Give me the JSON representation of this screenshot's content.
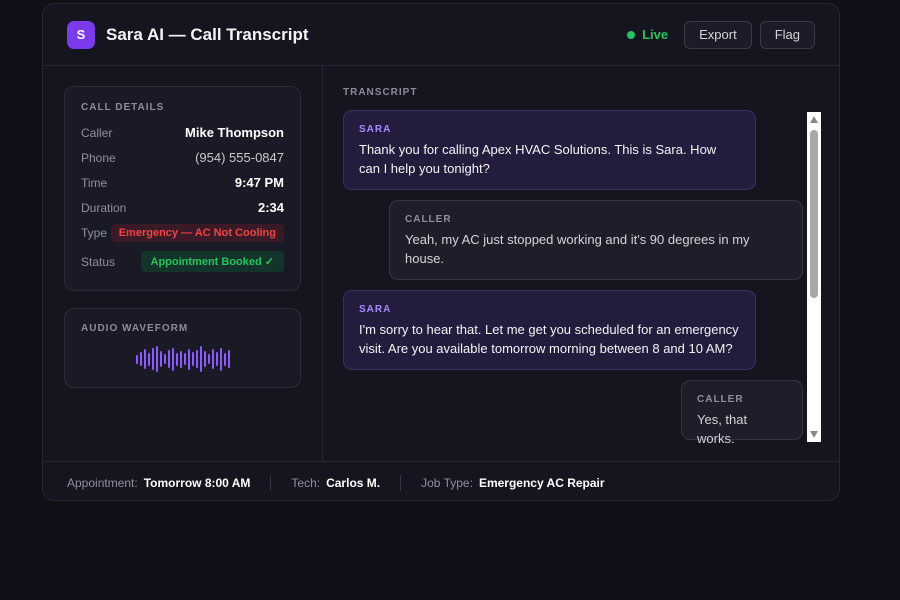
{
  "header": {
    "logo_letter": "S",
    "title": "Sara AI — Call Transcript",
    "live_label": "Live",
    "export_label": "Export",
    "flag_label": "Flag"
  },
  "call_details": {
    "title": "CALL DETAILS",
    "caller_label": "Caller",
    "caller": "Mike Thompson",
    "phone_label": "Phone",
    "phone": "(954) 555-0847",
    "time_label": "Time",
    "time": "9:47 PM",
    "duration_label": "Duration",
    "duration": "2:34",
    "type_label": "Type",
    "type": "Emergency — AC Not Cooling",
    "status_label": "Status",
    "status": "Appointment Booked ✓"
  },
  "waveform": {
    "title": "AUDIO WAVEFORM",
    "levels": [
      0.35,
      0.55,
      0.75,
      0.5,
      0.85,
      1.0,
      0.6,
      0.4,
      0.7,
      0.9,
      0.5,
      0.65,
      0.45,
      0.8,
      0.55,
      0.7,
      1.0,
      0.6,
      0.4,
      0.75,
      0.55,
      0.9,
      0.5,
      0.7
    ]
  },
  "transcript": {
    "label": "TRANSCRIPT",
    "messages": [
      {
        "speaker": "SARA",
        "text": "Thank you for calling Apex HVAC Solutions. This is Sara. How can I help you tonight?"
      },
      {
        "speaker": "CALLER",
        "text": "Yeah, my AC just stopped working and it's 90 degrees in my house."
      },
      {
        "speaker": "SARA",
        "text": "I'm sorry to hear that. Let me get you scheduled for an emergency visit. Are you available tomorrow morning between 8 and 10 AM?"
      },
      {
        "speaker": "CALLER",
        "text": "Yes, that works."
      }
    ]
  },
  "footer": {
    "appointment_label": "Appointment:",
    "appointment": "Tomorrow 8:00 AM",
    "tech_label": "Tech:",
    "tech": "Carlos M.",
    "job_type_label": "Job Type:",
    "job_type": "Emergency AC Repair"
  },
  "colors": {
    "accent": "#7c3aed",
    "live": "#22c55e",
    "emergency": "#ef4444",
    "booked": "#22c55e"
  }
}
